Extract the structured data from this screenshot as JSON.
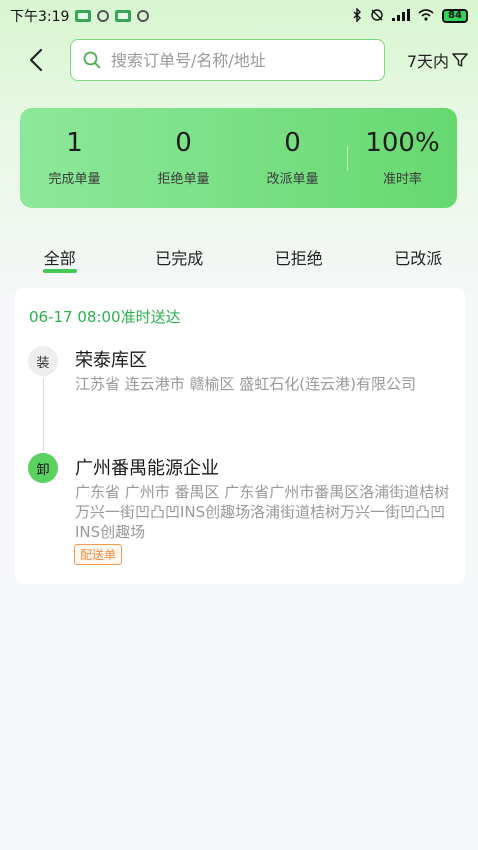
{
  "status_bar": {
    "time": "下午3:19",
    "battery": "84"
  },
  "search": {
    "placeholder": "搜索订单号/名称/地址",
    "value": ""
  },
  "filter": {
    "label": "7天内"
  },
  "stats": [
    {
      "value": "1",
      "label": "完成单量"
    },
    {
      "value": "0",
      "label": "拒绝单量"
    },
    {
      "value": "0",
      "label": "改派单量"
    },
    {
      "value": "100%",
      "label": "准时率"
    }
  ],
  "tabs": [
    "全部",
    "已完成",
    "已拒绝",
    "已改派"
  ],
  "active_tab": "全部",
  "order": {
    "time": "06-17 08:00准时送达",
    "load": {
      "badge": "装",
      "name": "荣泰库区",
      "address": "江苏省 连云港市 赣榆区 盛虹石化(连云港)有限公司"
    },
    "unload": {
      "badge": "卸",
      "name": "广州番禺能源企业",
      "address": "广东省 广州市 番禺区 广东省广州市番禺区洛浦街道桔树万兴一街凹凸凹INS创趣场洛浦街道桔树万兴一街凹凸凹INS创趣场"
    },
    "tag": "配送单"
  },
  "colors": {
    "accent": "#44c957",
    "time_green": "#28b24b",
    "tag_orange": "#f08a3c"
  }
}
